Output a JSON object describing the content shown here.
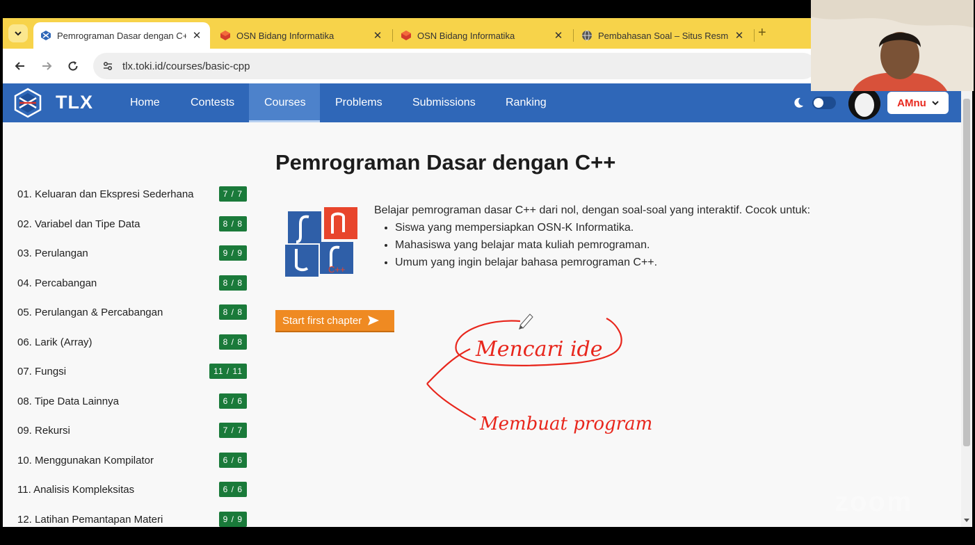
{
  "browser": {
    "tabs": [
      {
        "title": "Pemrograman Dasar dengan C++",
        "active": true,
        "favicon": "tlx-icon"
      },
      {
        "title": "OSN Bidang Informatika",
        "active": false,
        "favicon": "osn-icon"
      },
      {
        "title": "OSN Bidang Informatika",
        "active": false,
        "favicon": "osn-icon"
      },
      {
        "title": "Pembahasan Soal – Situs Resmi",
        "active": false,
        "favicon": "globe-icon"
      }
    ],
    "url": "tlx.toki.id/courses/basic-cpp"
  },
  "site": {
    "logo_text": "TLX",
    "nav": [
      "Home",
      "Contests",
      "Courses",
      "Problems",
      "Submissions",
      "Ranking"
    ],
    "active_nav": "Courses",
    "username": "AMnu"
  },
  "chapters": [
    {
      "label": "01. Keluaran dan Ekspresi Sederhana",
      "progress": "7 / 7"
    },
    {
      "label": "02. Variabel dan Tipe Data",
      "progress": "8 / 8"
    },
    {
      "label": "03. Perulangan",
      "progress": "9 / 9"
    },
    {
      "label": "04. Percabangan",
      "progress": "8 / 8"
    },
    {
      "label": "05. Perulangan & Percabangan",
      "progress": "8 / 8"
    },
    {
      "label": "06. Larik (Array)",
      "progress": "8 / 8"
    },
    {
      "label": "07. Fungsi",
      "progress": "11 / 11"
    },
    {
      "label": "08. Tipe Data Lainnya",
      "progress": "6 / 6"
    },
    {
      "label": "09. Rekursi",
      "progress": "7 / 7"
    },
    {
      "label": "10. Menggunakan Kompilator",
      "progress": "6 / 6"
    },
    {
      "label": "11. Analisis Kompleksitas",
      "progress": "6 / 6"
    },
    {
      "label": "12. Latihan Pemantapan Materi",
      "progress": "9 / 9"
    }
  ],
  "course": {
    "title": "Pemrograman Dasar dengan C++",
    "intro": "Belajar pemrograman dasar C++ dari nol, dengan soal-soal yang interaktif. Cocok untuk:",
    "audience": [
      "Siswa yang mempersiapkan OSN-K Informatika.",
      "Mahasiswa yang belajar mata kuliah pemrograman.",
      "Umum yang ingin belajar bahasa pemrograman C++."
    ],
    "start_button": "Start first chapter"
  },
  "annotations": {
    "note1": "Mencari ide",
    "note2": "Membuat program",
    "color": "#e8261c"
  },
  "overlay": {
    "watermark": "zoom"
  },
  "colors": {
    "tabbar": "#f7d34a",
    "site_nav": "#2f67b8",
    "badge_green": "#1a7a3a",
    "start_orange": "#ef8a22"
  }
}
